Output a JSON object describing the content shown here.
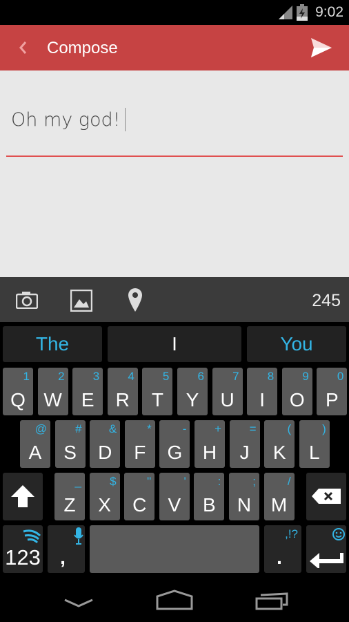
{
  "status_bar": {
    "time": "9:02",
    "icons": [
      "signal-icon",
      "battery-charging-icon"
    ]
  },
  "app_bar": {
    "title": "Compose",
    "back_icon": "chevron-left-icon",
    "send_icon": "send-icon",
    "color": "#c64343"
  },
  "compose": {
    "message": "Oh my god!"
  },
  "toolbar": {
    "icons": [
      "camera-icon",
      "image-icon",
      "location-pin-icon"
    ],
    "char_count": "245"
  },
  "keyboard": {
    "accent": "#33b5e5",
    "suggestions": [
      "The",
      "I",
      "You"
    ],
    "row1": [
      {
        "k": "Q",
        "a": "1"
      },
      {
        "k": "W",
        "a": "2"
      },
      {
        "k": "E",
        "a": "3"
      },
      {
        "k": "R",
        "a": "4"
      },
      {
        "k": "T",
        "a": "5"
      },
      {
        "k": "Y",
        "a": "6"
      },
      {
        "k": "U",
        "a": "7"
      },
      {
        "k": "I",
        "a": "8"
      },
      {
        "k": "O",
        "a": "9"
      },
      {
        "k": "P",
        "a": "0"
      }
    ],
    "row2": [
      {
        "k": "A",
        "a": "@"
      },
      {
        "k": "S",
        "a": "#"
      },
      {
        "k": "D",
        "a": "&"
      },
      {
        "k": "F",
        "a": "*"
      },
      {
        "k": "G",
        "a": "-"
      },
      {
        "k": "H",
        "a": "+"
      },
      {
        "k": "J",
        "a": "="
      },
      {
        "k": "K",
        "a": "("
      },
      {
        "k": "L",
        "a": ")"
      }
    ],
    "row3": [
      {
        "k": "Z",
        "a": "_"
      },
      {
        "k": "X",
        "a": "$"
      },
      {
        "k": "C",
        "a": "\""
      },
      {
        "k": "V",
        "a": "'"
      },
      {
        "k": "B",
        "a": ":"
      },
      {
        "k": "N",
        "a": ";"
      },
      {
        "k": "M",
        "a": "/"
      }
    ],
    "numbers_label": "123",
    "comma": ",",
    "period": ".",
    "period_alt": ",!?"
  },
  "nav_bar": {
    "icons": [
      "back-icon",
      "home-icon",
      "recents-icon"
    ]
  }
}
